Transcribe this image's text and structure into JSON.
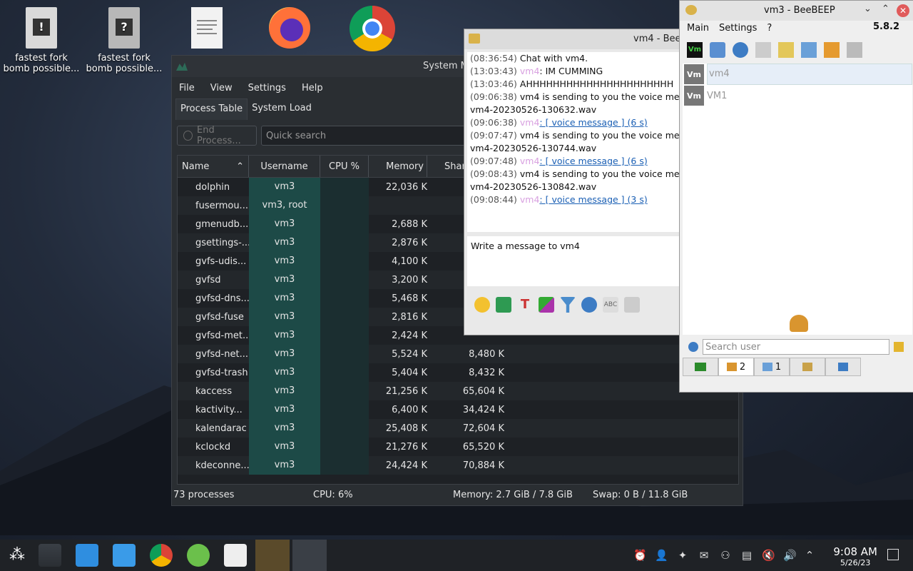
{
  "desktop": {
    "icons": [
      {
        "label": "fastest fork bomb possible..."
      },
      {
        "label": "fastest fork bomb possible..."
      }
    ]
  },
  "sysmon": {
    "title": "System M",
    "menu": [
      "File",
      "View",
      "Settings",
      "Help"
    ],
    "tabs": [
      "Process Table",
      "System Load"
    ],
    "end_process": "End Process...",
    "search_placeholder": "Quick search",
    "columns": [
      "Name",
      "Username",
      "CPU %",
      "Memory",
      "Shar"
    ],
    "rows": [
      {
        "name": "dolphin",
        "user": "vm3",
        "mem": "22,036 K",
        "shared": "1"
      },
      {
        "name": "fusermou...",
        "user": "vm3, root",
        "mem": "",
        "shared": ""
      },
      {
        "name": "gmenudb...",
        "user": "vm3",
        "mem": "2,688 K",
        "shared": ""
      },
      {
        "name": "gsettings-...",
        "user": "vm3",
        "mem": "2,876 K",
        "shared": ""
      },
      {
        "name": "gvfs-udis...",
        "user": "vm3",
        "mem": "4,100 K",
        "shared": ""
      },
      {
        "name": "gvfsd",
        "user": "vm3",
        "mem": "3,200 K",
        "shared": ""
      },
      {
        "name": "gvfsd-dns...",
        "user": "vm3",
        "mem": "5,468 K",
        "shared": ""
      },
      {
        "name": "gvfsd-fuse",
        "user": "vm3",
        "mem": "2,816 K",
        "shared": ""
      },
      {
        "name": "gvfsd-met...",
        "user": "vm3",
        "mem": "2,424 K",
        "shared": ""
      },
      {
        "name": "gvfsd-net...",
        "user": "vm3",
        "mem": "5,524 K",
        "shared": "8,480 K"
      },
      {
        "name": "gvfsd-trash",
        "user": "vm3",
        "mem": "5,404 K",
        "shared": "8,432 K"
      },
      {
        "name": "kaccess",
        "user": "vm3",
        "mem": "21,256 K",
        "shared": "65,604 K"
      },
      {
        "name": "kactivity...",
        "user": "vm3",
        "mem": "6,400 K",
        "shared": "34,424 K"
      },
      {
        "name": "kalendarac",
        "user": "vm3",
        "mem": "25,408 K",
        "shared": "72,604 K"
      },
      {
        "name": "kclockd",
        "user": "vm3",
        "mem": "21,276 K",
        "shared": "65,520 K"
      },
      {
        "name": "kdeconne...",
        "user": "vm3",
        "mem": "24,424 K",
        "shared": "70,884 K"
      }
    ],
    "status": {
      "processes": "73 processes",
      "cpu": "CPU: 6%",
      "memory": "Memory: 2.7 GiB / 7.8 GiB",
      "swap": "Swap: 0 B / 11.8 GiB"
    }
  },
  "chat": {
    "title": "vm4 - Bee",
    "messages": [
      {
        "ts": "(08:36:54)",
        "nick": "",
        "text": "Chat with vm4."
      },
      {
        "ts": "(13:03:43)",
        "nick": "vm4",
        "text": ": IM CUMMING"
      },
      {
        "ts": "(13:03:46)",
        "nick": "",
        "text": "AHHHHHHHHHHHHHHHHHHHHHH"
      },
      {
        "ts": "(09:06:38)",
        "nick": "",
        "text": "vm4 is sending to you the voice me"
      },
      {
        "ts": "",
        "nick": "",
        "text": "vm4-20230526-130632.wav"
      },
      {
        "ts": "(09:06:38)",
        "nick": "vm4",
        "text": ": [ voice message ] (6 s)"
      },
      {
        "ts": "(09:07:47)",
        "nick": "",
        "text": "vm4 is sending to you the voice me"
      },
      {
        "ts": "",
        "nick": "",
        "text": "vm4-20230526-130744.wav"
      },
      {
        "ts": "(09:07:48)",
        "nick": "vm4",
        "text": ": [ voice message ] (6 s)"
      },
      {
        "ts": "(09:08:43)",
        "nick": "",
        "text": "vm4 is sending to you the voice me"
      },
      {
        "ts": "",
        "nick": "",
        "text": "vm4-20230526-130842.wav"
      },
      {
        "ts": "(09:08:44)",
        "nick": "vm4",
        "text": ": [ voice message ] (3 s)"
      }
    ],
    "input_placeholder": "Write a message to vm4"
  },
  "bee": {
    "title": "vm3 - BeeBEEP",
    "menu": [
      "Main",
      "Settings",
      "?"
    ],
    "version": "5.8.2",
    "users": [
      {
        "avatar": "Vm",
        "name": "vm4"
      },
      {
        "avatar": "Vm",
        "name": "VM1"
      }
    ],
    "search_placeholder": "Search user",
    "tabs": [
      {
        "count": "2"
      },
      {
        "count": "1"
      },
      {
        "count": ""
      },
      {
        "count": ""
      }
    ]
  },
  "taskbar": {
    "time": "9:08 AM",
    "date": "5/26/23"
  }
}
